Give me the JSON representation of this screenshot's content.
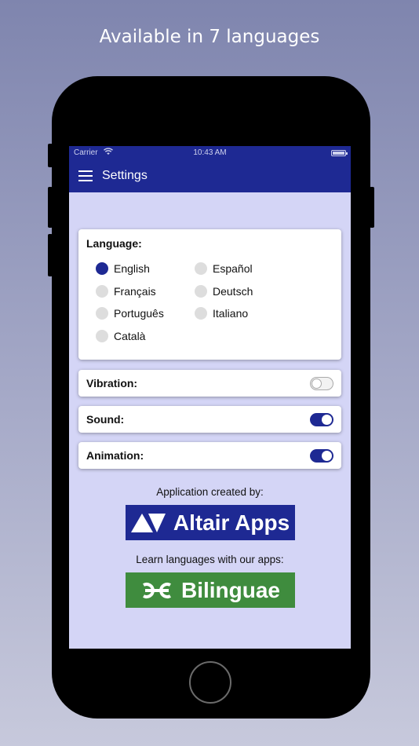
{
  "headline": "Available in 7 languages",
  "status_bar": {
    "carrier": "Carrier",
    "time": "10:43 AM"
  },
  "navbar": {
    "title": "Settings"
  },
  "language": {
    "title": "Language:",
    "options": [
      "English",
      "Español",
      "Français",
      "Deutsch",
      "Português",
      "Italiano",
      "Català"
    ],
    "selected": "English"
  },
  "vibration": {
    "label": "Vibration:",
    "enabled": false
  },
  "sound": {
    "label": "Sound:",
    "enabled": true
  },
  "animation": {
    "label": "Animation:",
    "enabled": true
  },
  "credits": {
    "created_by": "Application created by:",
    "altair_logo": "Altair Apps",
    "learn_text": "Learn languages with our apps:",
    "bilinguae_logo": "Bilinguae"
  },
  "colors": {
    "primary": "#1e2993",
    "screen_bg": "#d4d5f6",
    "bilinguae_green": "#3f8c3e"
  }
}
